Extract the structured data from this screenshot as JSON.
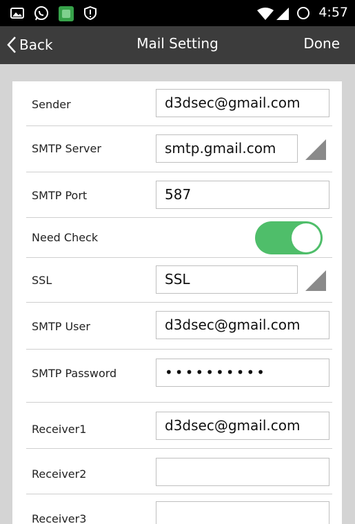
{
  "status_bar": {
    "time": "4:57",
    "left_icons": [
      "photo-icon",
      "whatsapp-icon",
      "app-icon",
      "shield-alert-icon"
    ],
    "right_icons": [
      "wifi-icon",
      "signal-icon",
      "battery-circle-icon"
    ]
  },
  "nav": {
    "back_label": "Back",
    "title": "Mail Setting",
    "done_label": "Done"
  },
  "colors": {
    "toggle_on": "#4fbe6a",
    "nav_bg": "#3c3c3c",
    "status_bg": "#000000"
  },
  "form": {
    "sender": {
      "label": "Sender",
      "value": "d3dsec@gmail.com"
    },
    "smtp_server": {
      "label": "SMTP Server",
      "value": "smtp.gmail.com"
    },
    "smtp_port": {
      "label": "SMTP Port",
      "value": "587"
    },
    "need_check": {
      "label": "Need Check",
      "on": true
    },
    "ssl": {
      "label": "SSL",
      "value": "SSL"
    },
    "smtp_user": {
      "label": "SMTP User",
      "value": "d3dsec@gmail.com"
    },
    "smtp_password": {
      "label": "SMTP Password",
      "value": "••••••••••"
    },
    "receiver1": {
      "label": "Receiver1",
      "value": "d3dsec@gmail.com"
    },
    "receiver2": {
      "label": "Receiver2",
      "value": ""
    },
    "receiver3": {
      "label": "Receiver3",
      "value": ""
    }
  }
}
